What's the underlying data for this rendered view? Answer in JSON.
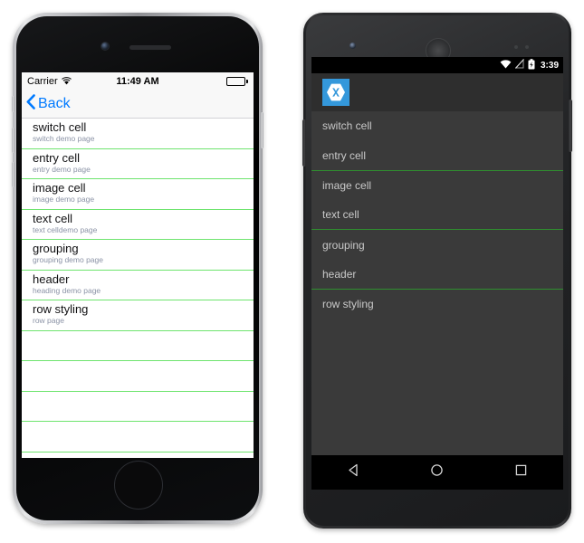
{
  "ios": {
    "status": {
      "carrier": "Carrier",
      "wifi_icon": "wifi-icon",
      "time": "11:49 AM",
      "battery_icon": "battery-full-icon"
    },
    "nav": {
      "back_label": "Back",
      "back_chevron_icon": "chevron-left-icon",
      "accent_color": "#007AFF"
    },
    "list": {
      "separator_color": "#6ee46e",
      "rows": [
        {
          "title": "switch cell",
          "detail": "switch demo page"
        },
        {
          "title": "entry cell",
          "detail": "entry demo page"
        },
        {
          "title": "image cell",
          "detail": "image demo page"
        },
        {
          "title": "text cell",
          "detail": "text celldemo page"
        },
        {
          "title": "grouping",
          "detail": "grouping demo page"
        },
        {
          "title": "header",
          "detail": "heading demo page"
        },
        {
          "title": "row styling",
          "detail": "row page"
        }
      ],
      "empty_row_count": 4
    },
    "hardware": {
      "camera_icon": "front-camera-icon",
      "speaker_icon": "earpiece-speaker-icon",
      "home_button_icon": "home-button-icon",
      "silent_switch_icon": "silent-switch-icon",
      "volume_up_icon": "volume-up-button-icon",
      "volume_down_icon": "volume-down-button-icon",
      "power_button_icon": "power-button-icon"
    }
  },
  "android": {
    "status": {
      "wifi_icon": "wifi-icon",
      "signal_icon": "signal-no-sim-icon",
      "battery_icon": "battery-charging-icon",
      "time": "3:39"
    },
    "actionbar": {
      "app_icon": "xamarin-logo-icon",
      "logo_color": "#3498db"
    },
    "list": {
      "separator_color": "#2f8f2f",
      "rows": [
        {
          "title": "switch cell",
          "separator": false
        },
        {
          "title": "entry cell",
          "separator": true
        },
        {
          "title": "image cell",
          "separator": false
        },
        {
          "title": "text cell",
          "separator": true
        },
        {
          "title": "grouping",
          "separator": false
        },
        {
          "title": "header",
          "separator": true
        },
        {
          "title": "row styling",
          "separator": false
        }
      ]
    },
    "navbar": {
      "back_icon": "nav-back-icon",
      "home_icon": "nav-home-icon",
      "recents_icon": "nav-recents-icon"
    },
    "hardware": {
      "camera_icon": "front-camera-icon",
      "speaker_icon": "earpiece-speaker-icon",
      "sensor_icon": "proximity-sensor-icon",
      "volume_button_icon": "volume-button-icon",
      "power_button_icon": "power-button-icon"
    }
  }
}
